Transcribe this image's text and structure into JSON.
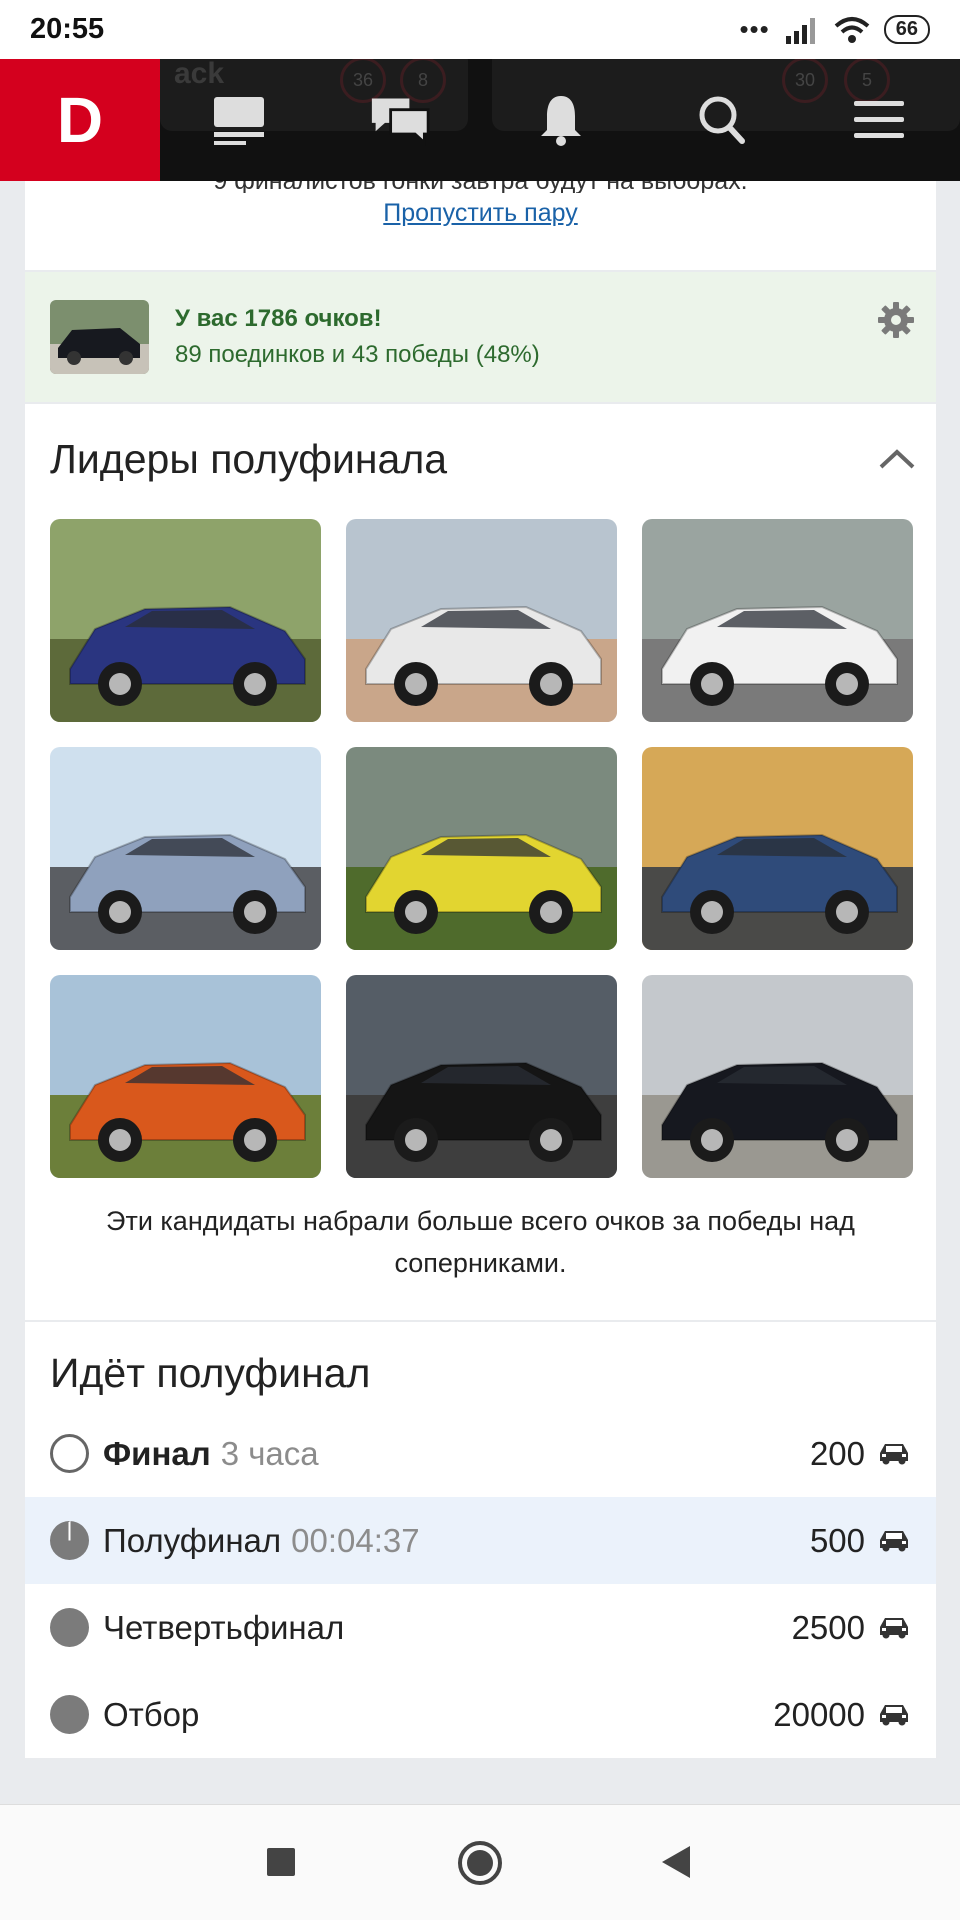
{
  "status_bar": {
    "time": "20:55",
    "battery": "66"
  },
  "header": {
    "logo": "D",
    "ghost_left": {
      "text": "ack",
      "count_a": "36",
      "count_b": "8"
    },
    "ghost_right": {
      "count_a": "30",
      "count_b": "5"
    },
    "icons": [
      "feed-icon",
      "messages-icon",
      "bell-icon",
      "search-icon",
      "menu-icon"
    ]
  },
  "duel": {
    "text": "9 финалистов гонки завтра будут на выборах.",
    "skip_link": "Пропустить пару"
  },
  "score": {
    "headline": "У вас 1786 очков!",
    "details": "89 поединков и 43 победы (48%)"
  },
  "leaders": {
    "title": "Лидеры полуфинала",
    "photos": [
      {
        "name": "blue-hatchback",
        "body": "#2a3580",
        "sky": "#8ea36a",
        "ground": "#5d6a3a"
      },
      {
        "name": "white-bmw-e21",
        "body": "#e8e8e8",
        "sky": "#b8c4cf",
        "ground": "#c9a68a"
      },
      {
        "name": "white-audi-tt",
        "body": "#f1f1f1",
        "sky": "#9aa4a0",
        "ground": "#7a7a7a"
      },
      {
        "name": "silver-subaru-impreza",
        "body": "#8fa1bd",
        "sky": "#cfe0ee",
        "ground": "#5b5e63"
      },
      {
        "name": "yellow-lancer-evo",
        "body": "#e2d530",
        "sky": "#7b8a7e",
        "ground": "#4f6b2c"
      },
      {
        "name": "blue-subaru-wrx",
        "body": "#2f4b7a",
        "sky": "#d6a857",
        "ground": "#4a4a48"
      },
      {
        "name": "orange-lada-niva",
        "body": "#d9581c",
        "sky": "#a8c2d8",
        "ground": "#6c7f3a"
      },
      {
        "name": "black-vw-golf",
        "body": "#151515",
        "sky": "#555d66",
        "ground": "#3e3e3e"
      },
      {
        "name": "black-bmw-e38",
        "body": "#16181f",
        "sky": "#c4c8cc",
        "ground": "#9a9891"
      }
    ],
    "caption": "Эти кандидаты набрали больше всего очков за победы над соперниками."
  },
  "stages": {
    "title": "Идёт полуфинал",
    "items": [
      {
        "name": "Финал",
        "meta": "3 часа",
        "count": "200",
        "state": "upcoming"
      },
      {
        "name": "Полуфинал",
        "meta": "00:04:37",
        "count": "500",
        "state": "active"
      },
      {
        "name": "Четвертьфинал",
        "meta": "",
        "count": "2500",
        "state": "done"
      },
      {
        "name": "Отбор",
        "meta": "",
        "count": "20000",
        "state": "done"
      }
    ]
  }
}
